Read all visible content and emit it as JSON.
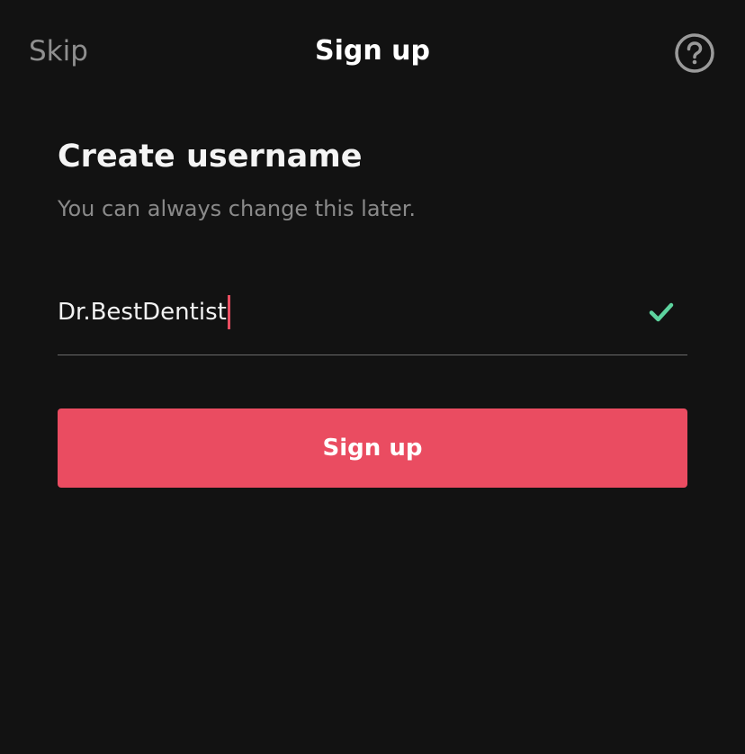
{
  "nav": {
    "skip_label": "Skip",
    "title": "Sign up",
    "help_icon": "question-circle-icon"
  },
  "form": {
    "heading": "Create username",
    "subheading": "You can always change this later.",
    "username_value": "Dr.BestDentist",
    "valid_icon": "checkmark-icon",
    "submit_label": "Sign up"
  },
  "colors": {
    "background": "#121212",
    "accent": "#ea4c61",
    "valid": "#5dd39e",
    "muted_text": "#8a8a8a"
  }
}
